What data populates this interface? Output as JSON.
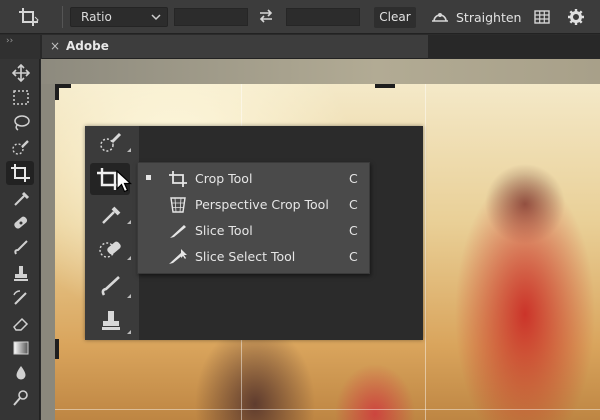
{
  "options_bar": {
    "ratio_label": "Ratio",
    "clear_label": "Clear",
    "straighten_label": "Straighten"
  },
  "tab": {
    "close_glyph": "×",
    "title": "Adobe"
  },
  "panel_collapse_glyph": "››",
  "toolbar_icons": [
    "move-icon",
    "marquee-icon",
    "lasso-icon",
    "quick-selection-icon",
    "crop-icon",
    "eyedropper-icon",
    "healing-brush-icon",
    "brush-icon",
    "clone-stamp-icon",
    "history-brush-icon",
    "eraser-icon",
    "gradient-icon",
    "blur-icon",
    "dodge-icon"
  ],
  "flyout": {
    "items": [
      {
        "label": "Crop Tool",
        "shortcut": "C",
        "icon": "crop-icon",
        "selected": true
      },
      {
        "label": "Perspective Crop Tool",
        "shortcut": "C",
        "icon": "perspective-crop-icon",
        "selected": false
      },
      {
        "label": "Slice Tool",
        "shortcut": "C",
        "icon": "slice-icon",
        "selected": false
      },
      {
        "label": "Slice Select Tool",
        "shortcut": "C",
        "icon": "slice-select-icon",
        "selected": false
      }
    ]
  },
  "colors": {
    "app_bg": "#2b2b2b",
    "options_bar": "#3c3c3c",
    "flyout_bg": "#4a4a4a",
    "text": "#e6e6e6"
  }
}
